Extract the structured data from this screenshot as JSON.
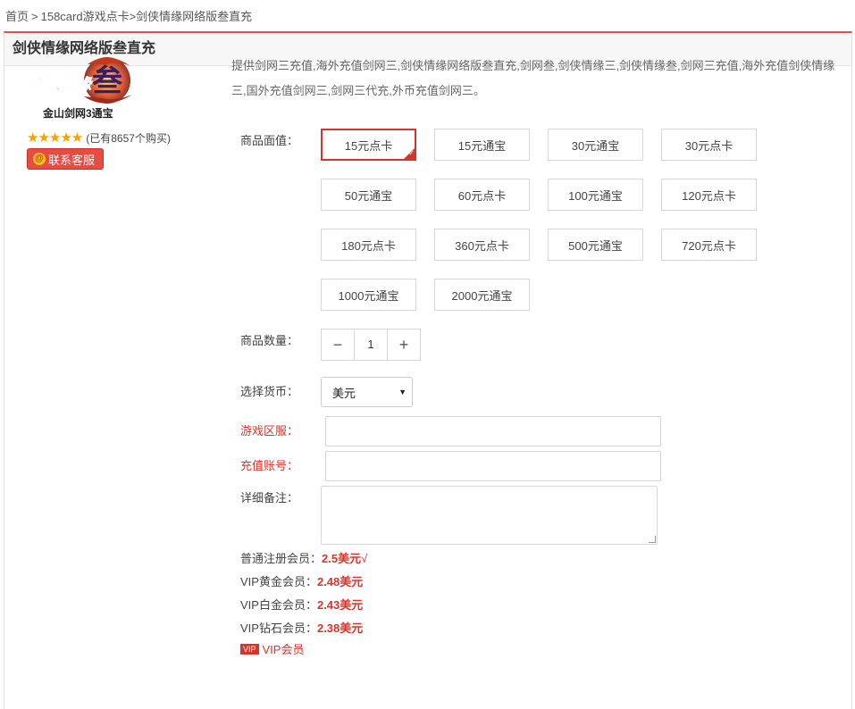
{
  "breadcrumb": {
    "home": "首页",
    "sep": ">",
    "category": "158card游戏点卡",
    "current": ">剑侠情缘网络版叁直充"
  },
  "header": {
    "title": "剑侠情缘网络版叁直充"
  },
  "product": {
    "logo_text": "剑侠情缘",
    "logo_glyph": "叁",
    "subtitle": "金山剑网3通宝",
    "stars": "★★★★★",
    "purchased": "(已有8657个购买)",
    "contact_label": "联系客服",
    "description": "提供剑网三充值,海外充值剑网三,剑侠情缘网络版叁直充,剑网叁,剑侠情缘三,剑侠情缘叁,剑网三充值,海外充值剑侠情缘三,国外充值剑网三,剑网三代充,外币充值剑网三。"
  },
  "form": {
    "denomination_label": "商品面值：",
    "denominations": [
      "15元点卡",
      "15元通宝",
      "30元通宝",
      "30元点卡",
      "50元通宝",
      "60元点卡",
      "100元通宝",
      "120元点卡",
      "180元点卡",
      "360元点卡",
      "500元通宝",
      "720元点卡",
      "1000元通宝",
      "2000元通宝"
    ],
    "selected_denomination": "15元点卡",
    "quantity_label": "商品数量：",
    "quantity_minus": "−",
    "quantity_value": "1",
    "quantity_plus": "+",
    "currency_label": "选择货币：",
    "currency_value": "美元",
    "server_label": "游戏区服：",
    "account_label": "充值账号：",
    "notes_label": "详细备注："
  },
  "pricing": {
    "normal_label": "普通注册会员：",
    "normal_price": "2.5美元",
    "normal_tick": "√",
    "gold_label": "VIP黄金会员：",
    "gold_price": "2.48美元",
    "platinum_label": "VIP白金会员：",
    "platinum_price": "2.43美元",
    "diamond_label": "VIP钻石会员：",
    "diamond_price": "2.38美元",
    "vip_badge": "VIP",
    "vip_link": "VIP会员"
  },
  "colors": {
    "accent": "#d9342b",
    "star": "#f5a100"
  }
}
